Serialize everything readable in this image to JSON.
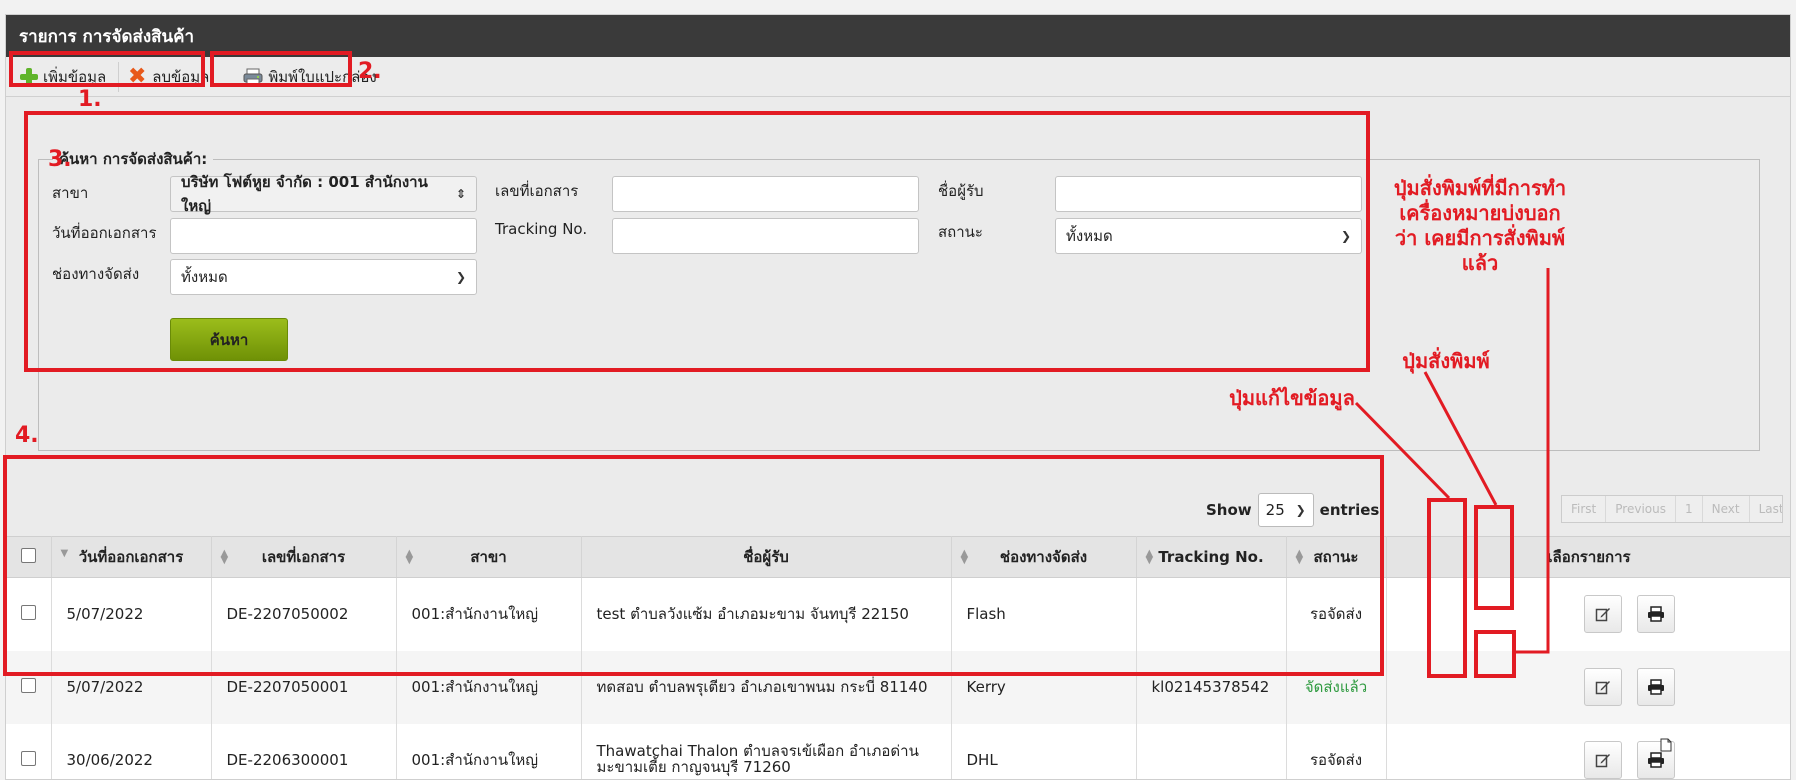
{
  "page_title": "รายการ การจัดส่งสินค้า",
  "toolbar": {
    "add_label": "เพิ่มข้อมูล",
    "delete_label": "ลบข้อมูล",
    "print_box_label": "พิมพ์ใบแปะกล่อง"
  },
  "search": {
    "legend": "ค้นหา การจัดส่งสินค้า:",
    "branch_label": "สาขา",
    "branch_value": "บริษัท โฟต์หูย จำกัด : 001 สำนักงานใหญ่",
    "doc_no_label": "เลขที่เอกสาร",
    "doc_no_value": "",
    "recipient_label": "ชื่อผู้รับ",
    "recipient_value": "",
    "doc_date_label": "วันที่ออกเอกสาร",
    "doc_date_value": "",
    "tracking_label": "Tracking No.",
    "tracking_value": "",
    "status_label": "สถานะ",
    "status_value": "ทั้งหมด",
    "channel_label": "ช่องทางจัดส่ง",
    "channel_value": "ทั้งหมด",
    "search_button": "ค้นหา"
  },
  "pager": {
    "show_label": "Show",
    "page_size": "25",
    "entries_label": "entries",
    "buttons": [
      "First",
      "Previous",
      "1",
      "Next",
      "Last"
    ]
  },
  "table": {
    "headers": [
      "วันที่ออกเอกสาร",
      "เลขที่เอกสาร",
      "สาขา",
      "ชื่อผู้รับ",
      "ช่องทางจัดส่ง",
      "Tracking No.",
      "สถานะ",
      "เลือกรายการ"
    ],
    "rows": [
      {
        "date": "5/07/2022",
        "doc_no": "DE-2207050002",
        "branch": "001:สำนักงานใหญ่",
        "recipient": "test ตำบลวังแซ้ม อำเภอมะขาม จันทบุรี 22150",
        "channel": "Flash",
        "tracking": "",
        "status": "รอจัดส่ง",
        "status_type": "wait"
      },
      {
        "date": "5/07/2022",
        "doc_no": "DE-2207050001",
        "branch": "001:สำนักงานใหญ่",
        "recipient": "ทดสอบ ตำบลพรุเตียว อำเภอเขาพนม กระบี่ 81140",
        "channel": "Kerry",
        "tracking": "kl02145378542",
        "status": "จัดส่งแล้ว",
        "status_type": "done"
      },
      {
        "date": "30/06/2022",
        "doc_no": "DE-2206300001",
        "branch": "001:สำนักงานใหญ่",
        "recipient": "Thawatchai Thalon ตำบลจรเข้เผือก อำเภอด่านมะขามเตี้ย กาญจนบุรี 71260",
        "channel": "DHL",
        "tracking": "",
        "status": "รอจัดส่ง",
        "status_type": "wait"
      }
    ]
  },
  "annotations": {
    "n1": "1.",
    "n2": "2.",
    "n3": "3.",
    "n4": "4.",
    "printed_note": "ปุ่มสั่งพิมพ์ที่มีการทำเครื่องหมายบ่งบอกว่า เคยมีการสั่งพิมพ์แล้ว",
    "print_note": "ปุ่มสั่งพิมพ์",
    "edit_note": "ปุ่มแก้ไขข้อมูล"
  },
  "colors": {
    "annotation_red": "#e21b23",
    "titlebar": "#3a3a3a",
    "search_button": "#8aab0f",
    "status_done": "#2e9a3f"
  }
}
